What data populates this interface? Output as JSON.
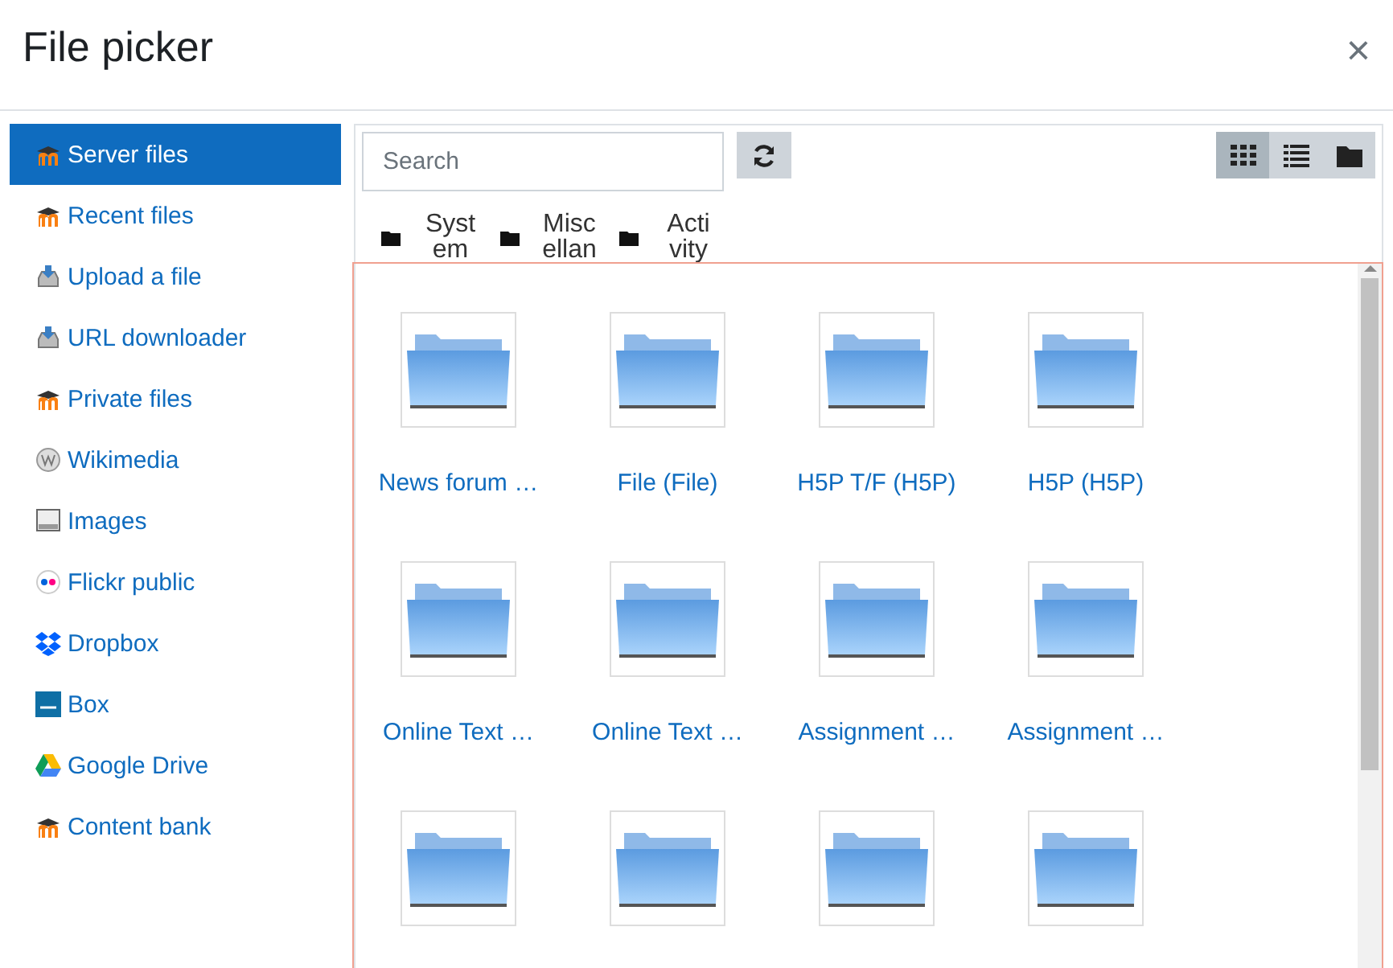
{
  "dialog": {
    "title": "File picker",
    "close": "×"
  },
  "sidebar": {
    "items": [
      {
        "label": "Server files",
        "kind": "moodle",
        "selected": true
      },
      {
        "label": "Recent files",
        "kind": "moodle",
        "selected": false
      },
      {
        "label": "Upload a file",
        "kind": "upload",
        "selected": false
      },
      {
        "label": "URL downloader",
        "kind": "upload",
        "selected": false
      },
      {
        "label": "Private files",
        "kind": "moodle",
        "selected": false
      },
      {
        "label": "Wikimedia",
        "kind": "wikimedia",
        "selected": false
      },
      {
        "label": "Images",
        "kind": "images",
        "selected": false
      },
      {
        "label": "Flickr public",
        "kind": "flickr",
        "selected": false
      },
      {
        "label": "Dropbox",
        "kind": "dropbox",
        "selected": false
      },
      {
        "label": "Box",
        "kind": "box",
        "selected": false
      },
      {
        "label": "Google Drive",
        "kind": "drive",
        "selected": false
      },
      {
        "label": "Content bank",
        "kind": "moodle",
        "selected": false
      }
    ]
  },
  "search": {
    "placeholder": "Search"
  },
  "views": [
    {
      "kind": "icons",
      "selected": true
    },
    {
      "kind": "list",
      "selected": false
    },
    {
      "kind": "tree",
      "selected": false
    }
  ],
  "breadcrumb": [
    {
      "label": "System"
    },
    {
      "label": "Miscellan"
    },
    {
      "label": "Activity"
    }
  ],
  "files": [
    {
      "kind": "folder",
      "name": "News forum …"
    },
    {
      "kind": "folder",
      "name": "File (File)"
    },
    {
      "kind": "folder",
      "name": "H5P T/F (H5P)"
    },
    {
      "kind": "folder",
      "name": "H5P (H5P)"
    },
    {
      "kind": "folder",
      "name": "Online Text …"
    },
    {
      "kind": "folder",
      "name": "Online Text …"
    },
    {
      "kind": "folder",
      "name": "Assignment …"
    },
    {
      "kind": "folder",
      "name": "Assignment …"
    },
    {
      "kind": "folder"
    },
    {
      "kind": "folder"
    },
    {
      "kind": "folder"
    },
    {
      "kind": "folder"
    }
  ]
}
